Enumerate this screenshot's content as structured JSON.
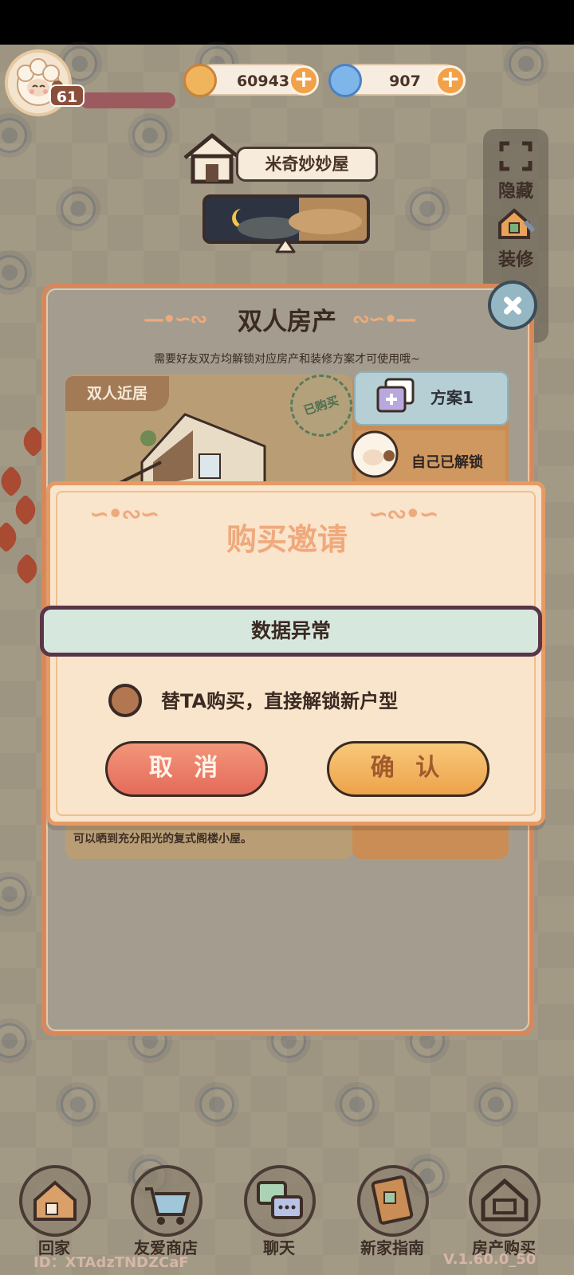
{
  "top_bar": {
    "level": "61",
    "coins": "60943",
    "gems": "907"
  },
  "house": {
    "name": "米奇妙妙屋"
  },
  "side_buttons": {
    "hide": "隐藏",
    "decorate": "装修"
  },
  "property_panel": {
    "title": "双人房产",
    "subtitle": "需要好友双方均解锁对应房产和装修方案才可使用哦~",
    "card_label": "双人近居",
    "stamp": "已购买",
    "plan_label": "方案1",
    "unlocked_label": "自己已解锁",
    "description": "可以晒到充分阳光的复式阁楼小屋。"
  },
  "modal": {
    "title": "购买邀请",
    "message": "数据异常",
    "option_label": "替TA购买，直接解锁新户型",
    "cancel": "取 消",
    "confirm": "确 认"
  },
  "bottom_nav": [
    {
      "label": "回家"
    },
    {
      "label": "友爱商店"
    },
    {
      "label": "聊天"
    },
    {
      "label": "新家指南"
    },
    {
      "label": "房产购买"
    }
  ],
  "footer": {
    "user_id": "ID：XTAdzTNDZCaF",
    "version": "V.1.60.0_50"
  },
  "colors": {
    "accent_orange": "#e79a64",
    "cancel_red": "#e46b5a",
    "confirm_yellow": "#eda34a",
    "modal_bg": "#f9e4cc"
  }
}
